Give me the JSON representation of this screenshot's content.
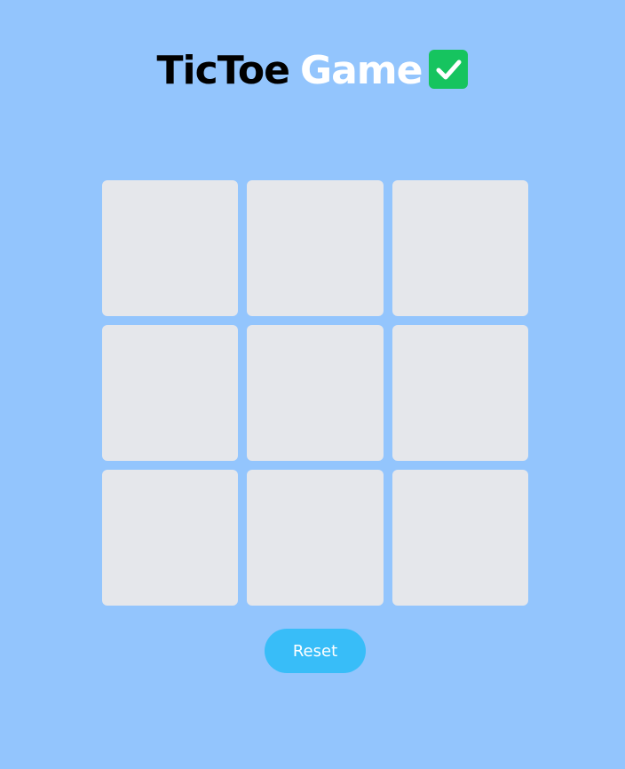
{
  "header": {
    "title_part_1": "TicToe",
    "title_part_2": "Game",
    "icon": "check-icon"
  },
  "board": {
    "cells": [
      "",
      "",
      "",
      "",
      "",
      "",
      "",
      "",
      ""
    ]
  },
  "controls": {
    "reset_label": "Reset"
  },
  "colors": {
    "background": "#93c5fd",
    "cell": "#e5e7eb",
    "reset_button": "#38bdf8",
    "check_icon": "#16c45f",
    "title_dark": "#000000",
    "title_light": "#ffffff"
  }
}
